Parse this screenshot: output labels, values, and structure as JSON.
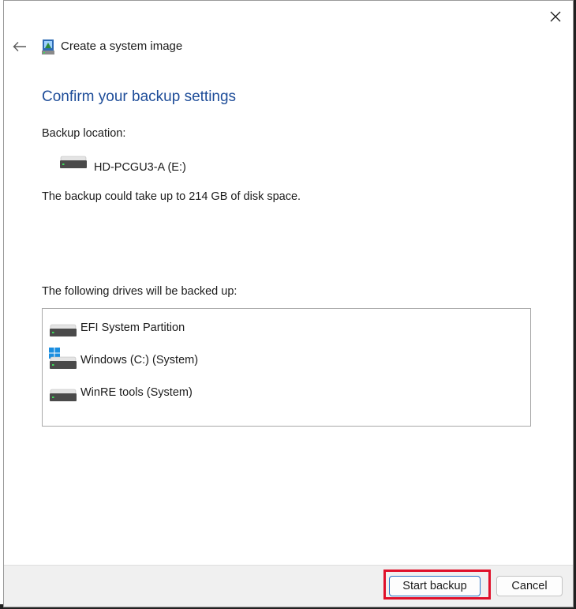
{
  "window": {
    "title": "Create a system image"
  },
  "heading": "Confirm your backup settings",
  "backup_location": {
    "label": "Backup location:",
    "drive_name": "HD-PCGU3-A (E:)"
  },
  "space_note": "The backup could take up to 214 GB of disk space.",
  "drives_section": {
    "label": "The following drives will be backed up:",
    "drives": [
      {
        "name": "EFI System Partition",
        "icon": "drive-icon"
      },
      {
        "name": "Windows (C:) (System)",
        "icon": "windows-drive-icon"
      },
      {
        "name": "WinRE tools (System)",
        "icon": "drive-icon"
      }
    ]
  },
  "buttons": {
    "start": "Start backup",
    "cancel": "Cancel"
  },
  "colors": {
    "heading": "#1e4d99",
    "highlight": "#e0102a",
    "windows_logo": "#1a8ee0"
  }
}
